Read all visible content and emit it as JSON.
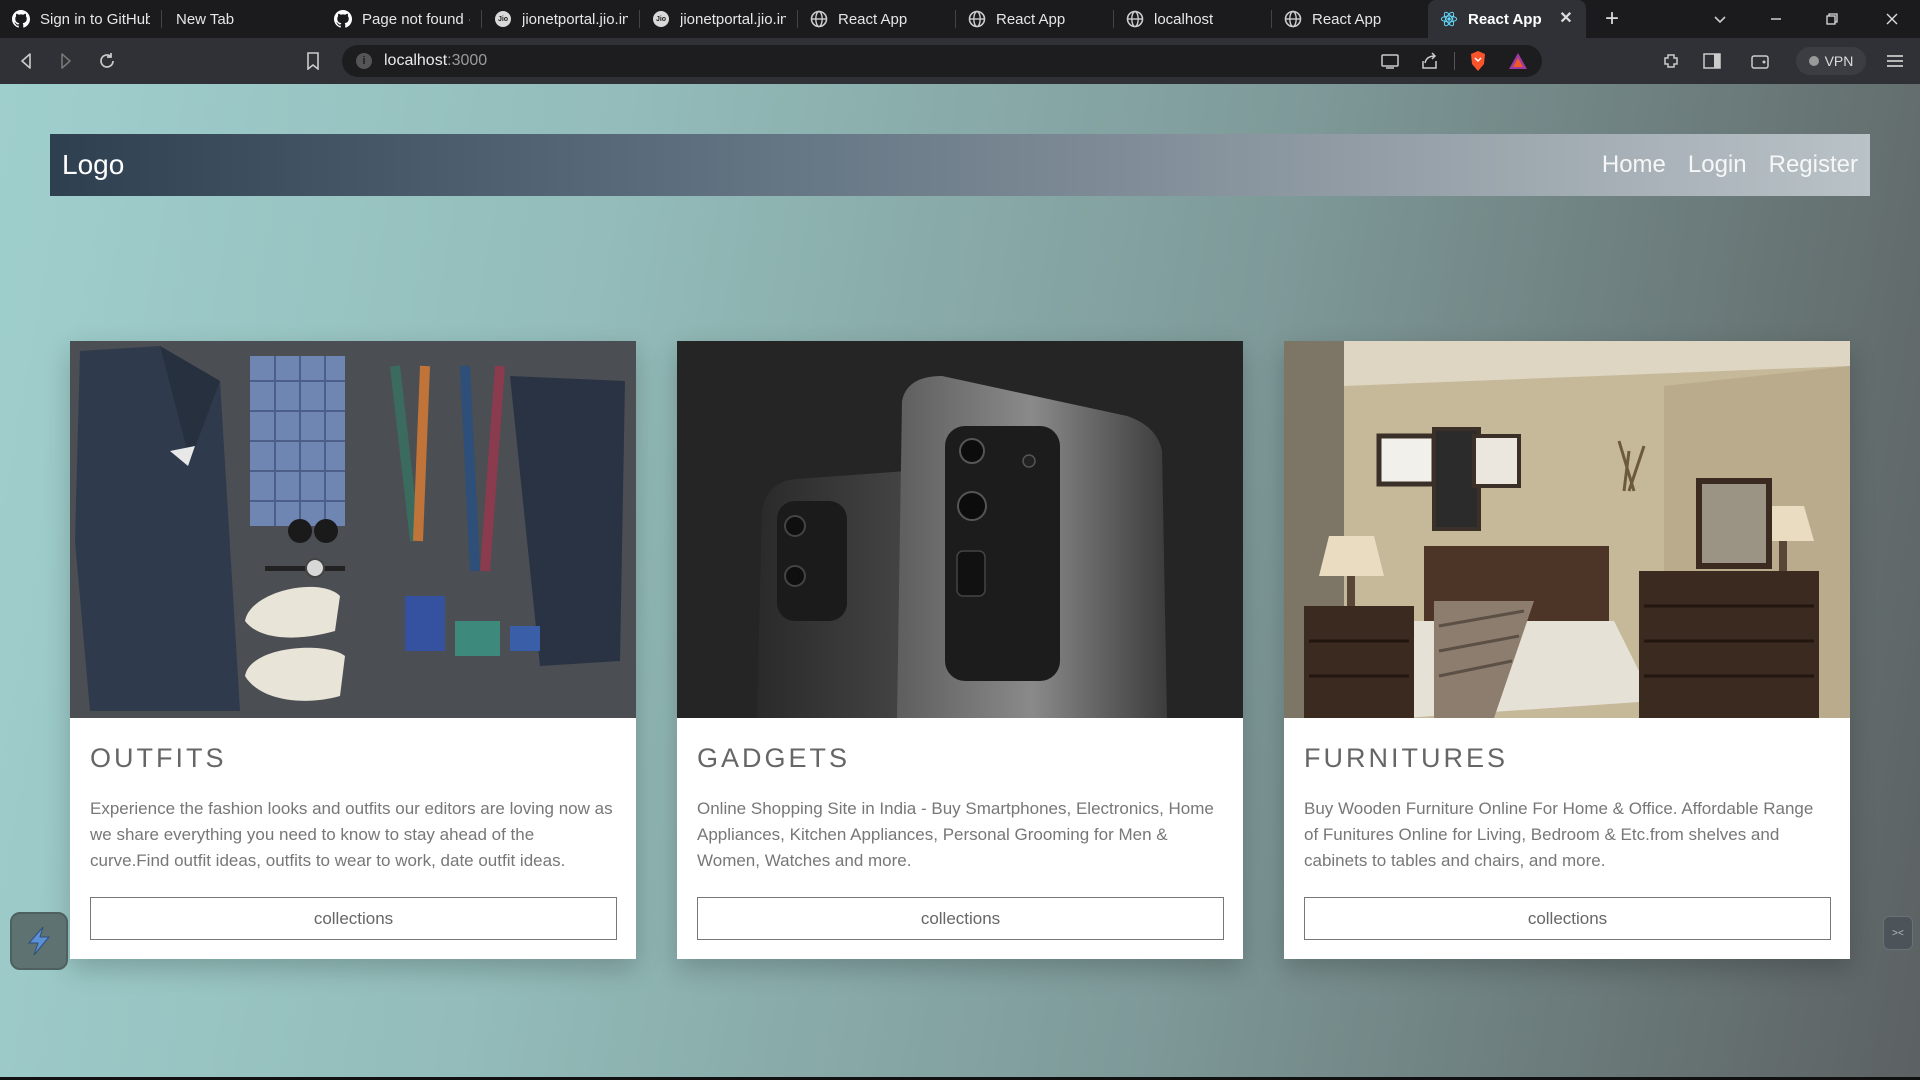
{
  "browser": {
    "tabs": [
      {
        "label": "Sign in to GitHub",
        "icon": "github-icon"
      },
      {
        "label": "New Tab",
        "icon": ""
      },
      {
        "label": "Page not found ·",
        "icon": "github-icon"
      },
      {
        "label": "jionetportal.jio.in",
        "icon": "jio-icon"
      },
      {
        "label": "jionetportal.jio.in",
        "icon": "jio-icon"
      },
      {
        "label": "React App",
        "icon": "globe-icon"
      },
      {
        "label": "React App",
        "icon": "globe-icon"
      },
      {
        "label": "localhost",
        "icon": "globe-icon"
      },
      {
        "label": "React App",
        "icon": "globe-icon"
      },
      {
        "label": "React App",
        "icon": "react-icon",
        "active": true
      }
    ],
    "jio_icon_text": "Jio",
    "url": {
      "host": "localhost",
      "port": ":3000"
    },
    "vpn_label": "VPN"
  },
  "site": {
    "logo": "Logo",
    "nav": {
      "home": "Home",
      "login": "Login",
      "register": "Register"
    },
    "cards": [
      {
        "title": "OUTFITS",
        "description": "Experience the fashion looks and outfits our editors are loving now as we share everything you need to know to stay ahead of the curve.Find outfit ideas, outfits to wear to work, date outfit ideas.",
        "button": "collections"
      },
      {
        "title": "GADGETS",
        "description": "Online Shopping Site in India - Buy Smartphones, Electronics, Home Appliances, Kitchen Appliances, Personal Grooming for Men & Women, Watches and more.",
        "button": "collections"
      },
      {
        "title": "FURNITURES",
        "description": "Buy Wooden Furniture Online For Home & Office. Affordable Range of Funitures Online for Living, Bedroom & Etc.from shelves and cabinets to tables and chairs, and more.",
        "button": "collections"
      }
    ]
  },
  "colors": {
    "accent_brave": "#fb542b",
    "page_gradient_start": "#9fcfcd",
    "page_gradient_end": "#5c6162"
  }
}
